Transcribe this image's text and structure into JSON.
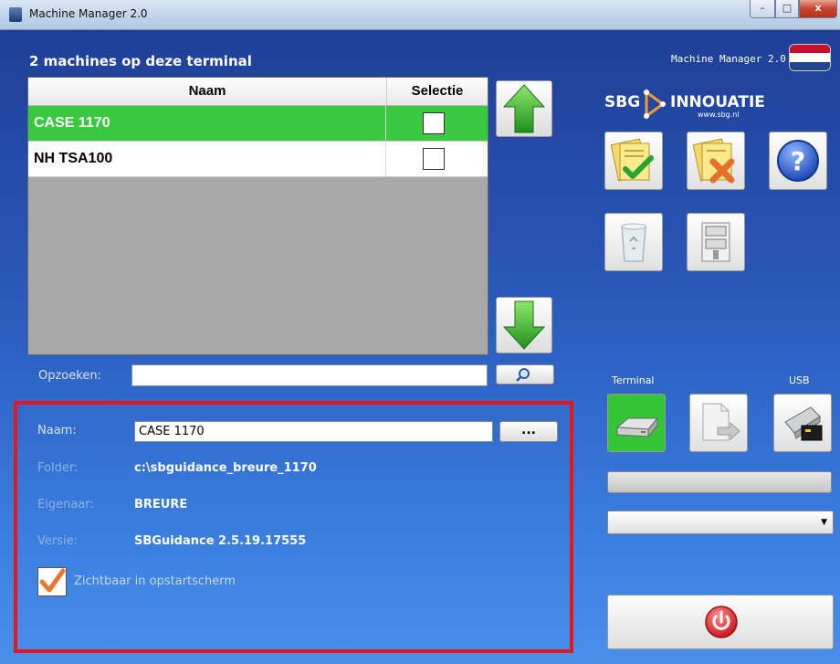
{
  "window": {
    "title": "Machine Manager 2.0",
    "min_glyph": "–",
    "max_glyph": "□",
    "close_glyph": "x"
  },
  "header": {
    "machine_count_text": "2 machines op deze terminal",
    "app_version": "Machine Manager 2.0",
    "flag_colors": [
      "#c8102e",
      "#ffffff",
      "#21468b"
    ]
  },
  "machine_list": {
    "columns": [
      "Naam",
      "Selectie"
    ],
    "rows": [
      {
        "name": "CASE 1170",
        "selected_row": true,
        "checked": false
      },
      {
        "name": "NH TSA100",
        "selected_row": false,
        "checked": false
      }
    ]
  },
  "search": {
    "label": "Opzoeken:",
    "value": ""
  },
  "details": {
    "name_label": "Naam:",
    "name_value": "CASE 1170",
    "browse_label": "...",
    "folder_label": "Folder:",
    "folder_value": "c:\\sbguidance_breure_1170",
    "owner_label": "Eigenaar:",
    "owner_value": "BREURE",
    "version_label": "Versie:",
    "version_value": "SBGuidance 2.5.19.17555",
    "visible_label": "Zichtbaar in opstartscherm",
    "visible_checked": true
  },
  "logo": {
    "left": "SBG",
    "right": "INNOUATIE",
    "url": "www.sbg.nl"
  },
  "transfer": {
    "terminal_label": "Terminal",
    "usb_label": "USB"
  },
  "icons": {
    "move_up": "arrow-up-icon",
    "move_down": "arrow-down-icon",
    "search": "magnifier-icon",
    "accept": "document-check-icon",
    "reject": "document-cross-icon",
    "help": "help-icon",
    "delete": "recycle-bin-icon",
    "archive": "zip-archive-icon",
    "terminal": "hard-drive-icon",
    "copy": "copy-file-icon",
    "usb": "usb-drive-icon",
    "power": "power-icon"
  },
  "colors": {
    "selected_row": "#39c840",
    "highlight_border": "#e5161c",
    "terminal_active": "#35c435",
    "power": "#e3262b"
  }
}
